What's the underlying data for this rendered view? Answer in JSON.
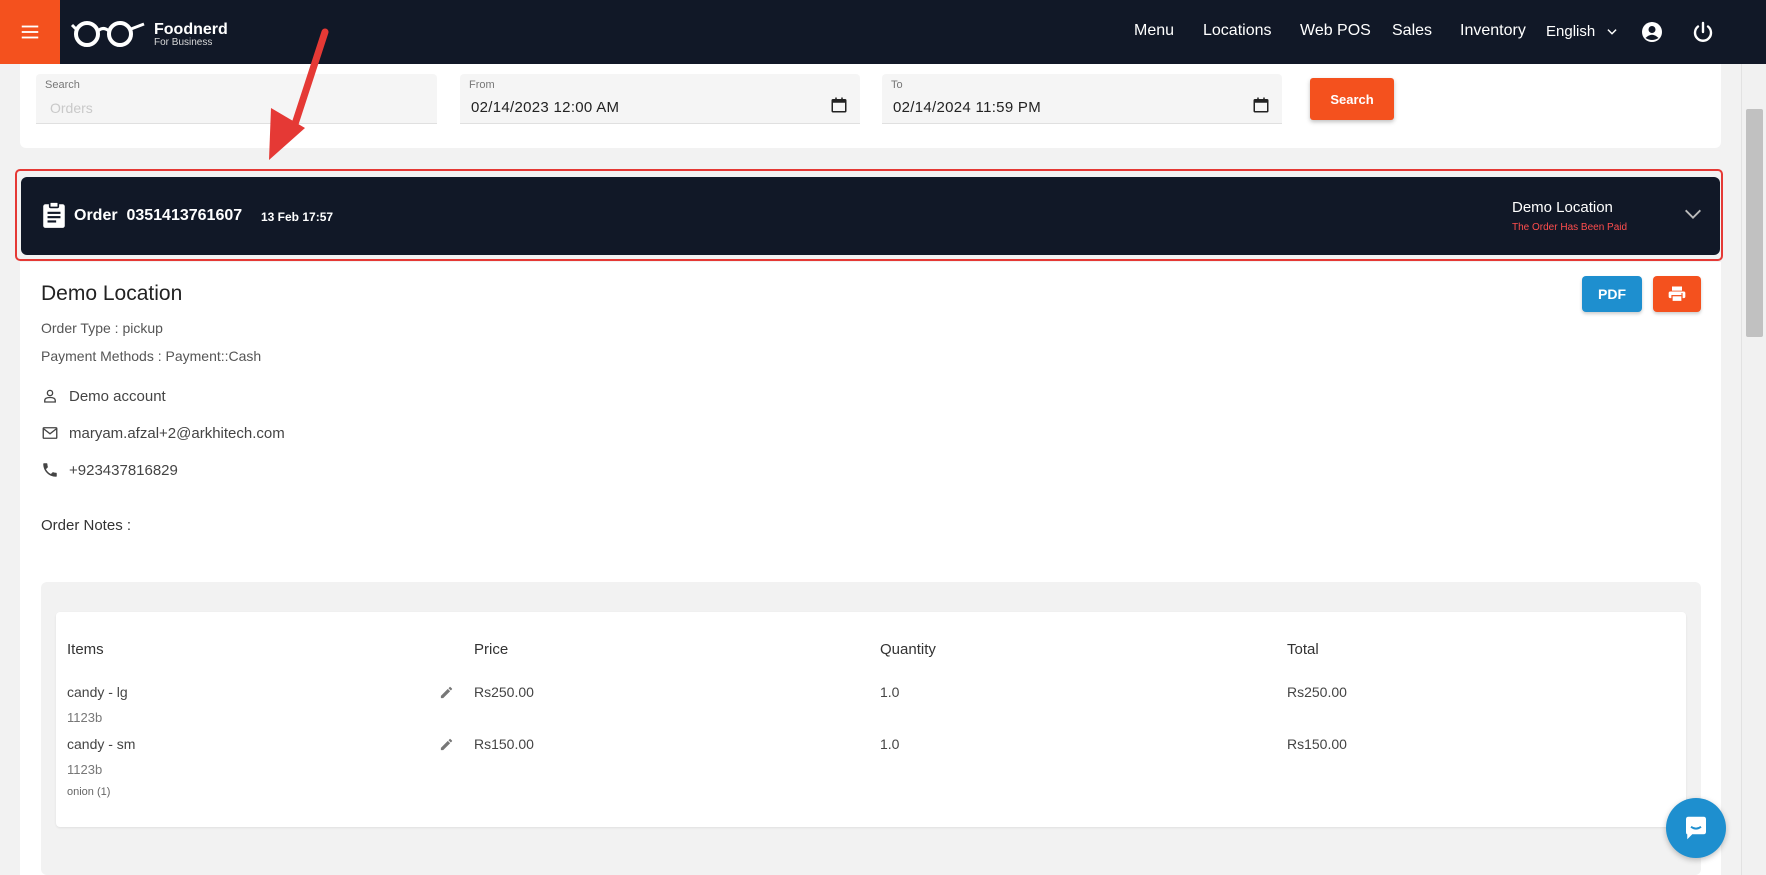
{
  "brand": {
    "name": "Foodnerd",
    "tagline": "For Business",
    "accent": "#f4511e",
    "nav_bg": "#111827"
  },
  "nav": {
    "items": [
      "Menu",
      "Locations",
      "Web POS",
      "Sales",
      "Inventory"
    ],
    "language": "English"
  },
  "filters": {
    "search_label": "Search",
    "search_placeholder": "Orders",
    "from_label": "From",
    "from_value": "02/14/2023 12:00 AM",
    "to_label": "To",
    "to_value": "02/14/2024 11:59 PM",
    "search_button": "Search"
  },
  "order": {
    "title": "Order  0351413761607",
    "date": "13 Feb 17:57",
    "location": "Demo Location",
    "status": "The Order Has Been Paid"
  },
  "detail": {
    "location_title": "Demo Location",
    "order_type": "Order Type : pickup",
    "payment_methods": "Payment Methods : Payment::Cash",
    "customer_name": "Demo account",
    "email": "maryam.afzal+2@arkhitech.com",
    "phone": "+923437816829",
    "notes_label": "Order Notes :",
    "pdf_button": "PDF"
  },
  "items_table": {
    "headers": [
      "Items",
      "Price",
      "Quantity",
      "Total"
    ],
    "rows": [
      {
        "name": "candy - lg",
        "sku": "1123b",
        "price": "Rs250.00",
        "quantity": "1.0",
        "total": "Rs250.00"
      },
      {
        "name": "candy - sm",
        "sku": "1123b",
        "modifier": "onion (1)",
        "price": "Rs150.00",
        "quantity": "1.0",
        "total": "Rs150.00"
      }
    ]
  }
}
